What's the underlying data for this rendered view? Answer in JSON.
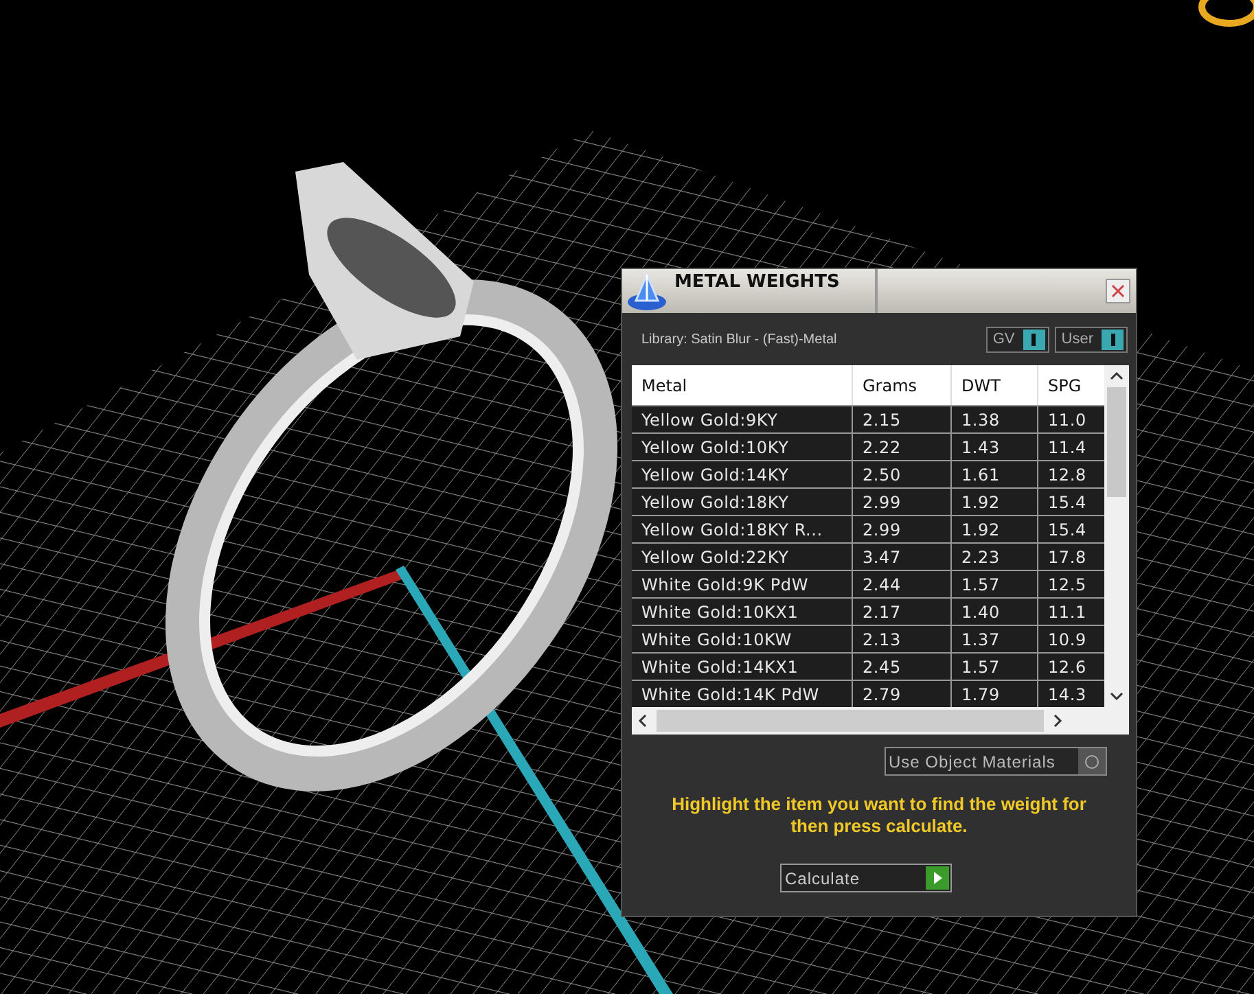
{
  "panel": {
    "title": "METAL WEIGHTS",
    "library": "Library: Satin Blur - (Fast)-Metal",
    "toggles": [
      {
        "label": "GV",
        "on": true
      },
      {
        "label": "User",
        "on": true
      }
    ],
    "table": {
      "columns": [
        "Metal",
        "Grams",
        "DWT",
        "SPG"
      ],
      "rows": [
        [
          "Yellow Gold:9KY",
          "2.15",
          "1.38",
          "11.0"
        ],
        [
          "Yellow Gold:10KY",
          "2.22",
          "1.43",
          "11.4"
        ],
        [
          "Yellow Gold:14KY",
          "2.50",
          "1.61",
          "12.8"
        ],
        [
          "Yellow Gold:18KY",
          "2.99",
          "1.92",
          "15.4"
        ],
        [
          "Yellow Gold:18KY R...",
          "2.99",
          "1.92",
          "15.4"
        ],
        [
          "Yellow Gold:22KY",
          "3.47",
          "2.23",
          "17.8"
        ],
        [
          "White Gold:9K PdW",
          "2.44",
          "1.57",
          "12.5"
        ],
        [
          "White Gold:10KX1",
          "2.17",
          "1.40",
          "11.1"
        ],
        [
          "White Gold:10KW",
          "2.13",
          "1.37",
          "10.9"
        ],
        [
          "White Gold:14KX1",
          "2.45",
          "1.57",
          "12.6"
        ],
        [
          "White Gold:14K PdW",
          "2.79",
          "1.79",
          "14.3"
        ]
      ]
    },
    "use_object_materials": {
      "label": "Use Object Materials",
      "checked": false
    },
    "message": "Highlight the item you want to find the weight for then press calculate.",
    "button": "Calculate"
  }
}
